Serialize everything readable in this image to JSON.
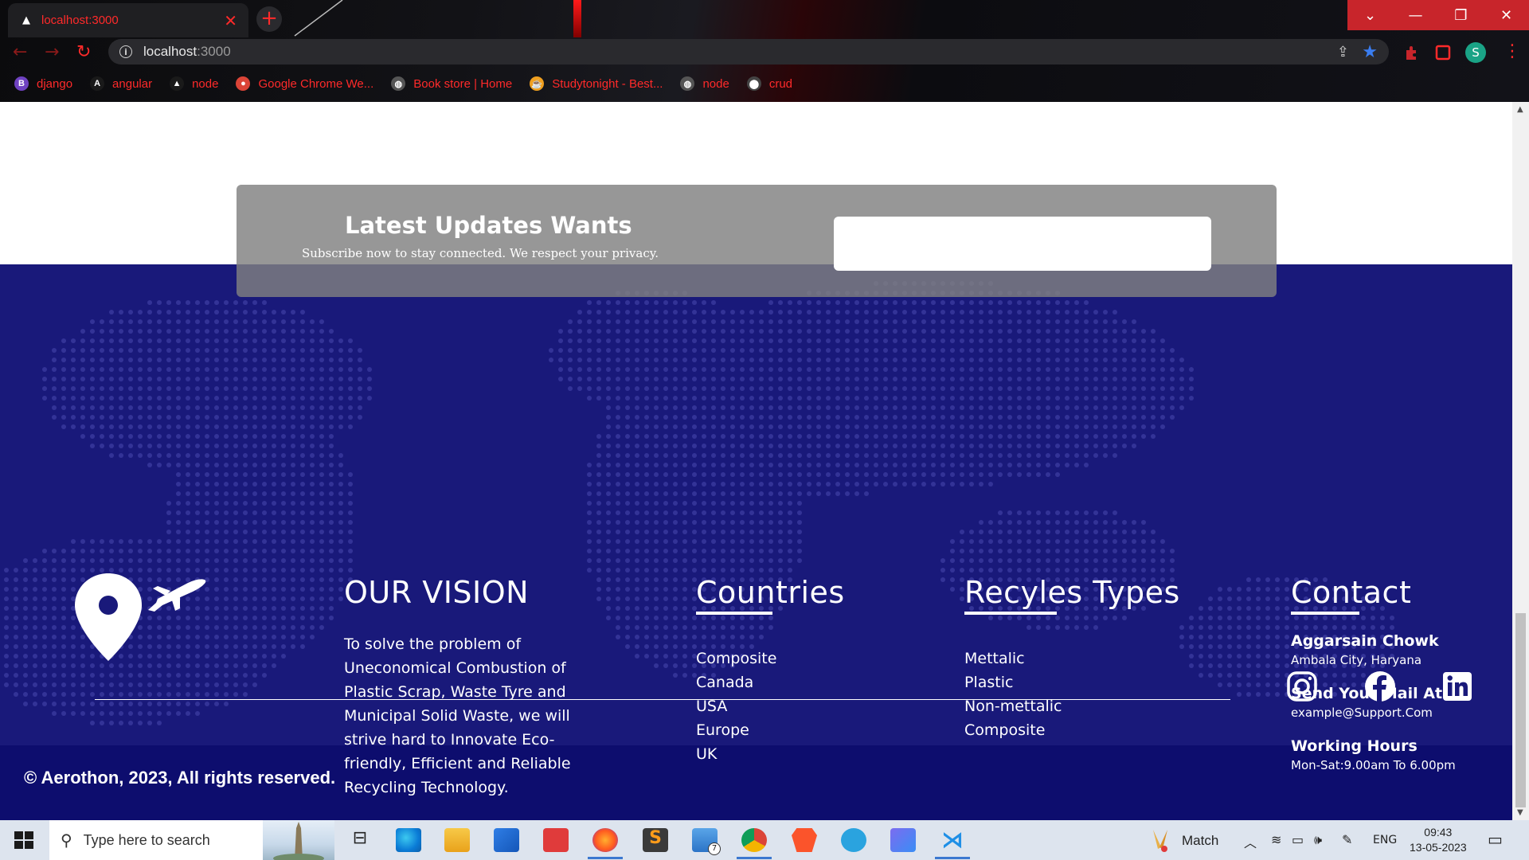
{
  "browser": {
    "tab_title": "localhost:3000",
    "url_host": "localhost",
    "url_port": ":3000",
    "bookmarks": [
      {
        "label": "django",
        "icon": "bootstrap-icon",
        "color": "#6f42c1",
        "glyph": "B"
      },
      {
        "label": "angular",
        "icon": "angular-icon",
        "color": "#1a1a1a",
        "glyph": "A"
      },
      {
        "label": "node",
        "icon": "triangle-icon",
        "color": "#1a1a1a",
        "glyph": "▲"
      },
      {
        "label": "Google Chrome We...",
        "icon": "chrome-icon",
        "color": "#db4437",
        "glyph": "●"
      },
      {
        "label": "Book store | Home",
        "icon": "globe-icon",
        "color": "#555555",
        "glyph": "◍"
      },
      {
        "label": "Studytonight - Best...",
        "icon": "studytonight-icon",
        "color": "#f0a020",
        "glyph": "☕"
      },
      {
        "label": "node",
        "icon": "globe-icon",
        "color": "#555555",
        "glyph": "◍"
      },
      {
        "label": "crud",
        "icon": "crud-icon",
        "color": "#444444",
        "glyph": "⬤"
      }
    ],
    "profile_initial": "S"
  },
  "newsletter": {
    "title": "Latest Updates Wants",
    "subtitle": "Subscribe now to stay connected. We respect your privacy.",
    "email_placeholder": ""
  },
  "vision": {
    "title": "OUR VISION",
    "text": "To solve the problem of Uneconomical Combustion of Plastic Scrap, Waste Tyre and Municipal Solid Waste, we will strive hard to Innovate Eco-friendly, Efficient and Reliable Recycling Technology."
  },
  "countries": {
    "title": "Countries",
    "items": [
      "Composite",
      "Canada",
      "USA",
      "Europe",
      "UK"
    ]
  },
  "recycles": {
    "title": "Recyles Types",
    "items": [
      "Mettalic",
      "Plastic",
      "Non-mettalic",
      "Composite"
    ]
  },
  "contact": {
    "title": "Contact",
    "address_label": "Aggarsain Chowk",
    "address_value": "Ambala City, Haryana",
    "mail_label": "Send Your Mail At",
    "mail_value": "example@Support.Com",
    "hours_label": "Working Hours",
    "hours_value": "Mon-Sat:9.00am To 6.00pm"
  },
  "social": [
    "instagram-icon",
    "facebook-icon",
    "linkedin-icon"
  ],
  "copyright": "© Aerothon, 2023, All rights reserved.",
  "taskbar": {
    "search_placeholder": "Type here to search",
    "weather_label": "Match",
    "lang": "ENG",
    "time": "09:43",
    "date": "13-05-2023",
    "mail_badge": "7"
  },
  "colors": {
    "footer_bg": "#19197a",
    "copy_bg": "#0d0d6e",
    "accent_red": "#ff2a2a"
  }
}
